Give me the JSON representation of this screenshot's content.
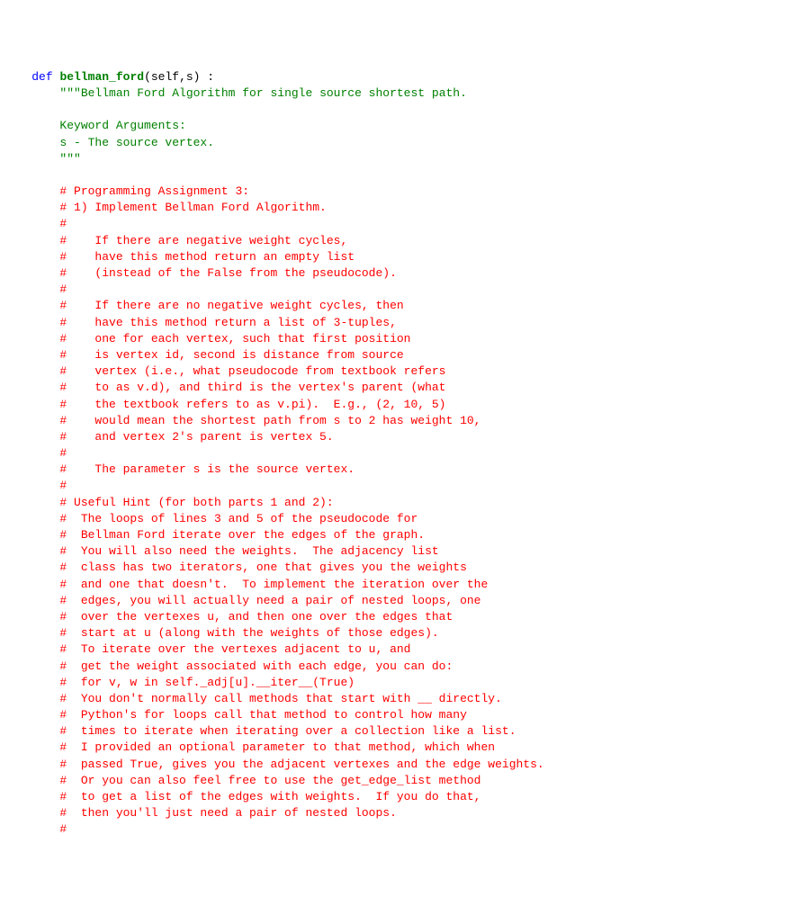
{
  "code": {
    "keyword_def": "def",
    "function_name": "bellman_ford",
    "params": "(self,s) :",
    "doc_open": "        \"\"\"",
    "doc_line1": "Bellman Ford Algorithm for single source shortest path.",
    "doc_blank1": "",
    "doc_line2": "        Keyword Arguments:",
    "doc_line3": "        s - The source vertex.",
    "doc_close": "        \"\"\"",
    "blank1": "",
    "comments": [
      "        # Programming Assignment 3:",
      "        # 1) Implement Bellman Ford Algorithm.",
      "        #",
      "        #    If there are negative weight cycles,",
      "        #    have this method return an empty list",
      "        #    (instead of the False from the pseudocode).",
      "        #",
      "        #    If there are no negative weight cycles, then",
      "        #    have this method return a list of 3-tuples,",
      "        #    one for each vertex, such that first position",
      "        #    is vertex id, second is distance from source",
      "        #    vertex (i.e., what pseudocode from textbook refers",
      "        #    to as v.d), and third is the vertex's parent (what",
      "        #    the textbook refers to as v.pi).  E.g., (2, 10, 5)",
      "        #    would mean the shortest path from s to 2 has weight 10,",
      "        #    and vertex 2's parent is vertex 5.",
      "        #",
      "        #    The parameter s is the source vertex.",
      "        #",
      "        # Useful Hint (for both parts 1 and 2):",
      "        #  The loops of lines 3 and 5 of the pseudocode for",
      "        #  Bellman Ford iterate over the edges of the graph.",
      "        #  You will also need the weights.  The adjacency list",
      "        #  class has two iterators, one that gives you the weights",
      "        #  and one that doesn't.  To implement the iteration over the",
      "        #  edges, you will actually need a pair of nested loops, one",
      "        #  over the vertexes u, and then one over the edges that",
      "        #  start at u (along with the weights of those edges).",
      "        #  To iterate over the vertexes adjacent to u, and",
      "        #  get the weight associated with each edge, you can do:",
      "        #  for v, w in self._adj[u].__iter__(True)",
      "        #  You don't normally call methods that start with __ directly.",
      "        #  Python's for loops call that method to control how many",
      "        #  times to iterate when iterating over a collection like a list.",
      "        #  I provided an optional parameter to that method, which when",
      "        #  passed True, gives you the adjacent vertexes and the edge weights.",
      "        #  Or you can also feel free to use the get_edge_list method",
      "        #  to get a list of the edges with weights.  If you do that,",
      "        #  then you'll just need a pair of nested loops.",
      "        #"
    ]
  }
}
